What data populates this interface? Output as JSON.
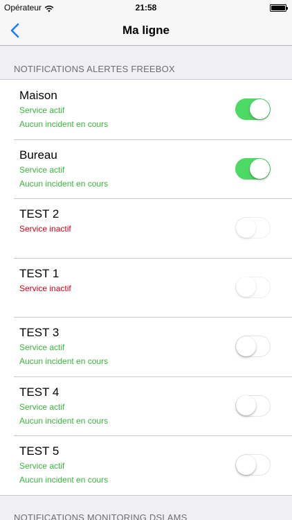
{
  "status_bar": {
    "carrier": "Opérateur",
    "time": "21:58"
  },
  "nav": {
    "title": "Ma ligne"
  },
  "sections": {
    "first_header": "NOTIFICATIONS ALERTES FREEBOX",
    "second_header": "NOTIFICATIONS MONITORING DSLAMS"
  },
  "items": [
    {
      "name": "Maison",
      "status": "Service actif",
      "incident": "Aucun incident en cours",
      "toggle": "on"
    },
    {
      "name": "Bureau",
      "status": "Service actif",
      "incident": "Aucun incident en cours",
      "toggle": "on"
    },
    {
      "name": "TEST 2",
      "status": "Service inactif",
      "incident": "",
      "toggle": "off-disabled"
    },
    {
      "name": "TEST 1",
      "status": "Service inactif",
      "incident": "",
      "toggle": "off-disabled"
    },
    {
      "name": "TEST 3",
      "status": "Service actif",
      "incident": "Aucun incident en cours",
      "toggle": "off"
    },
    {
      "name": "TEST 4",
      "status": "Service actif",
      "incident": "Aucun incident en cours",
      "toggle": "off"
    },
    {
      "name": "TEST 5",
      "status": "Service actif",
      "incident": "Aucun incident en cours",
      "toggle": "off"
    }
  ],
  "colors": {
    "accent_blue": "#157efb",
    "status_green": "#38b63c",
    "status_red": "#d0021b",
    "toggle_on": "#4cd964"
  }
}
